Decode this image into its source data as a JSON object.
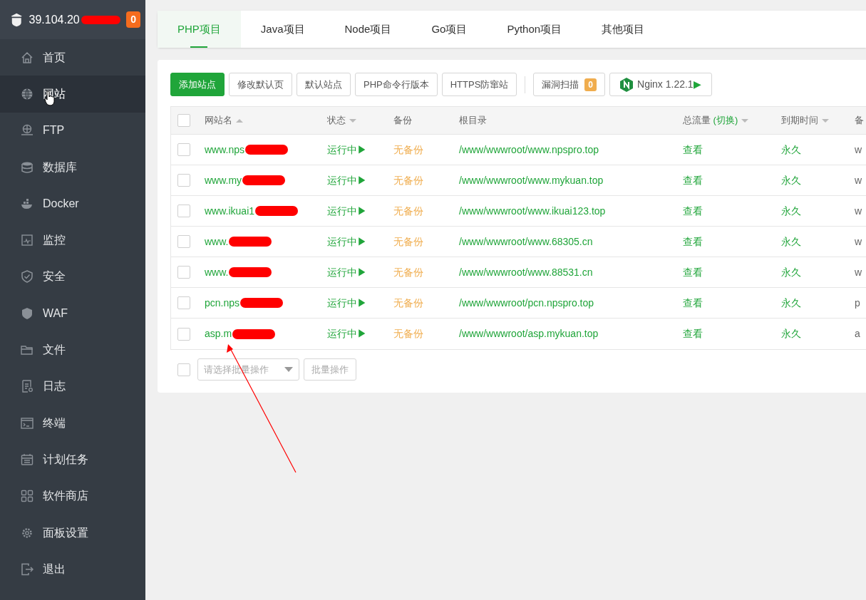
{
  "sidebar": {
    "server": "39.104.20",
    "server_redacted": true,
    "badge": "0",
    "items": [
      {
        "label": "首页",
        "selected": false
      },
      {
        "label": "网站",
        "selected": true
      },
      {
        "label": "FTP",
        "selected": false
      },
      {
        "label": "数据库",
        "selected": false
      },
      {
        "label": "Docker",
        "selected": false
      },
      {
        "label": "监控",
        "selected": false
      },
      {
        "label": "安全",
        "selected": false
      },
      {
        "label": "WAF",
        "selected": false
      },
      {
        "label": "文件",
        "selected": false
      },
      {
        "label": "日志",
        "selected": false
      },
      {
        "label": "终端",
        "selected": false
      },
      {
        "label": "计划任务",
        "selected": false
      },
      {
        "label": "软件商店",
        "selected": false
      },
      {
        "label": "面板设置",
        "selected": false
      },
      {
        "label": "退出",
        "selected": false
      }
    ]
  },
  "tabs": [
    {
      "label": "PHP项目",
      "selected": true
    },
    {
      "label": "Java项目",
      "selected": false
    },
    {
      "label": "Node项目",
      "selected": false
    },
    {
      "label": "Go项目",
      "selected": false
    },
    {
      "label": "Python项目",
      "selected": false
    },
    {
      "label": "其他项目",
      "selected": false
    }
  ],
  "toolbar": {
    "buttons": [
      {
        "label": "添加站点",
        "kind": "primary"
      },
      {
        "label": "修改默认页",
        "kind": "plain"
      },
      {
        "label": "默认站点",
        "kind": "plain"
      },
      {
        "label": "PHP命令行版本",
        "kind": "plain"
      },
      {
        "label": "HTTPS防窜站",
        "kind": "plain"
      }
    ],
    "scan": {
      "label": "漏洞扫描",
      "count": "0"
    },
    "nginx": {
      "label": "Nginx 1.22.1",
      "arrow": "▶"
    }
  },
  "table": {
    "select_all_checked": false,
    "columns": [
      {
        "label": "网站名",
        "kind": "ascending"
      },
      {
        "label": "状态",
        "kind": "descending"
      },
      {
        "label": "备份",
        "kind": "plain"
      },
      {
        "label": "根目录",
        "kind": "plain"
      },
      {
        "label": "总流量",
        "link": "(切换)",
        "kind": "descending"
      },
      {
        "label": "到期时间",
        "kind": "descending"
      },
      {
        "label": "备",
        "kind": "plain"
      }
    ],
    "rows": [
      {
        "name": "www.nps",
        "redacted": true,
        "status": "运行中▶",
        "backup": "无备份",
        "root": "/www/wwwroot/www.npspro.top",
        "traffic": "查看",
        "expiry": "永久",
        "column_8": "w",
        "checked": false
      },
      {
        "name": "www.my",
        "redacted": true,
        "status": "运行中▶",
        "backup": "无备份",
        "root": "/www/wwwroot/www.mykuan.top",
        "traffic": "查看",
        "expiry": "永久",
        "column_8": "w",
        "checked": false
      },
      {
        "name": "www.ikuai1",
        "redacted": true,
        "status": "运行中▶",
        "backup": "无备份",
        "root": "/www/wwwroot/www.ikuai123.top",
        "traffic": "查看",
        "expiry": "永久",
        "column_8": "w",
        "checked": false
      },
      {
        "name": "www.",
        "redacted": true,
        "status": "运行中▶",
        "backup": "无备份",
        "root": "/www/wwwroot/www.68305.cn",
        "traffic": "查看",
        "expiry": "永久",
        "column_8": "w",
        "checked": false
      },
      {
        "name": "www.",
        "redacted": true,
        "status": "运行中▶",
        "backup": "无备份",
        "root": "/www/wwwroot/www.88531.cn",
        "traffic": "查看",
        "expiry": "永久",
        "column_8": "w",
        "checked": false
      },
      {
        "name": "pcn.nps",
        "redacted": true,
        "status": "运行中▶",
        "backup": "无备份",
        "root": "/www/wwwroot/pcn.npspro.top",
        "traffic": "查看",
        "expiry": "永久",
        "column_8": "p",
        "checked": false
      },
      {
        "name": "asp.m",
        "redacted": true,
        "status": "运行中▶",
        "backup": "无备份",
        "root": "/www/wwwroot/asp.mykuan.top",
        "traffic": "查看",
        "expiry": "永久",
        "column_8": "a",
        "checked": false
      }
    ]
  },
  "batch": {
    "placeholder": "请选择批量操作",
    "button": "批量操作",
    "checked": false
  },
  "annotation_arrow": true
}
